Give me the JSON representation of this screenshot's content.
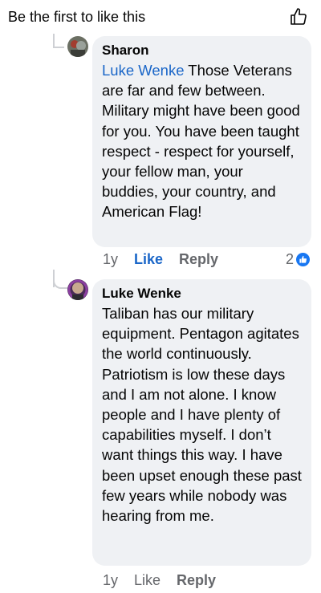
{
  "header": {
    "title": "Be the first to like this",
    "like_icon": "thumbs-up-outline-icon"
  },
  "comments": [
    {
      "author": "Sharon",
      "mention": "Luke Wenke",
      "text": " Those Veterans are far and few between.  Military might have been good for you.  You have been taught respect - respect for yourself, your fellow man, your buddies, your country, and American Flag!",
      "time": "1y",
      "like_label": "Like",
      "reply_label": "Reply",
      "reaction_count": "2",
      "reaction_icon": "like-reaction-icon"
    },
    {
      "author": "Luke Wenke",
      "text": "Taliban has our military equipment.  Pentagon agitates the world continuously.  Patriotism is low these days and I am not alone.  I know people and I have plenty of capabilities myself.  I don’t want things this way.  I have been upset enough these past few years while nobody was hearing from me.",
      "time": "1y",
      "like_label": "Like",
      "reply_label": "Reply"
    }
  ],
  "colors": {
    "bubble": "#eff1f4",
    "mention": "#1a66c8",
    "muted": "#65676b",
    "reaction": "#1877f2"
  }
}
